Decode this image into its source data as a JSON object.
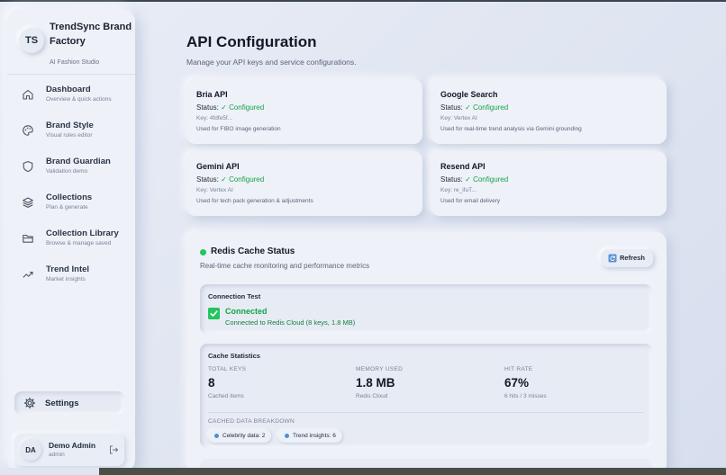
{
  "sidebar": {
    "brand": {
      "initials": "TS",
      "name": "TrendSync Brand Factory",
      "subtitle": "AI Fashion Studio"
    },
    "items": [
      {
        "label": "Dashboard",
        "sub": "Overview & quick actions",
        "icon": "home-icon"
      },
      {
        "label": "Brand Style",
        "sub": "Visual rules editor",
        "icon": "palette-icon"
      },
      {
        "label": "Brand Guardian",
        "sub": "Validation demo",
        "icon": "shield-icon"
      },
      {
        "label": "Collections",
        "sub": "Plan & generate",
        "icon": "layers-icon"
      },
      {
        "label": "Collection Library",
        "sub": "Browse & manage saved",
        "icon": "folder-icon"
      },
      {
        "label": "Trend Intel",
        "sub": "Market insights",
        "icon": "trending-up-icon"
      }
    ],
    "settings": {
      "label": "Settings",
      "icon": "gear-icon"
    },
    "user": {
      "initials": "DA",
      "name": "Demo Admin",
      "role": "admin"
    }
  },
  "header": {
    "title": "API Configuration",
    "subtitle": "Manage your API keys and service configurations."
  },
  "apis": [
    {
      "name": "Bria API",
      "status_label": "Status:",
      "status": "✓ Configured",
      "key": "Key: 4fdfe5f...",
      "use": "Used for FIBO image generation"
    },
    {
      "name": "Google Search",
      "status_label": "Status:",
      "status": "✓ Configured",
      "key": "Key: Vertex AI",
      "use": "Used for real-time trend analysis via Gemini grounding"
    },
    {
      "name": "Gemini API",
      "status_label": "Status:",
      "status": "✓ Configured",
      "key": "Key: Vertex AI",
      "use": "Used for tech pack generation & adjustments"
    },
    {
      "name": "Resend API",
      "status_label": "Status:",
      "status": "✓ Configured",
      "key": "Key: re_ifuT...",
      "use": "Used for email delivery"
    }
  ],
  "redis": {
    "title": "Redis Cache Status",
    "subtitle": "Real-time cache monitoring and performance metrics",
    "refresh_label": "Refresh",
    "connection": {
      "title": "Connection Test",
      "state": "Connected",
      "detail": "Connected to Redis Cloud (8 keys, 1.8 MB)"
    },
    "stats": {
      "title": "Cache Statistics",
      "items": [
        {
          "label": "TOTAL KEYS",
          "value": "8",
          "note": "Cached items"
        },
        {
          "label": "MEMORY USED",
          "value": "1.8 MB",
          "note": "Redis Cloud"
        },
        {
          "label": "HIT RATE",
          "value": "67%",
          "note": "6 hits / 3 misses"
        }
      ],
      "breakdown_label": "CACHED DATA BREAKDOWN",
      "chips": [
        "Celebrity data: 2",
        "Trend insights: 6"
      ]
    }
  },
  "colors": {
    "accent_green": "#16a34a",
    "dot_green": "#22c55e",
    "chip_dot": "#4a90d9"
  }
}
